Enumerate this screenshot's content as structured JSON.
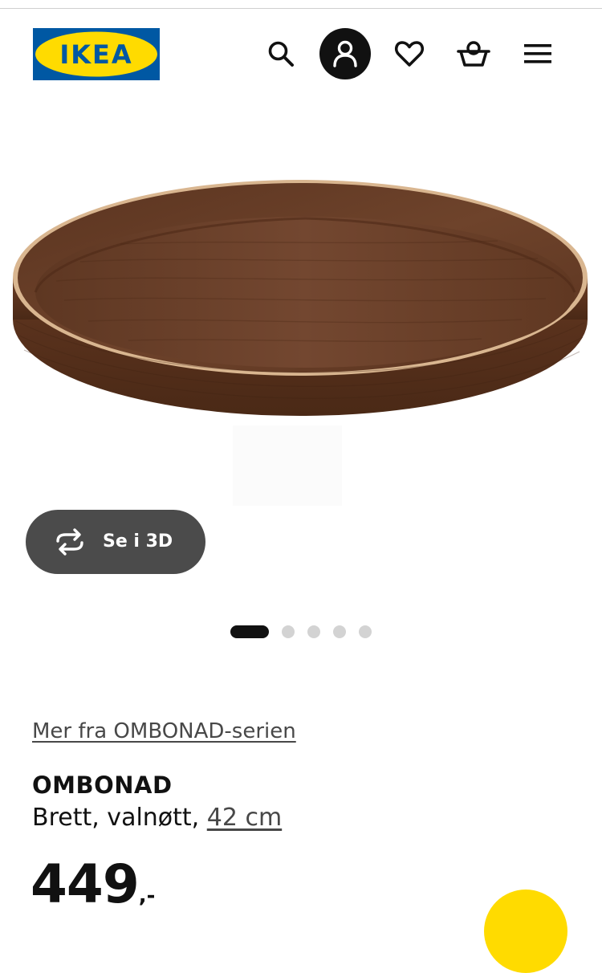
{
  "header": {
    "logo_text": "IKEA",
    "brand_colors": {
      "blue": "#0058a3",
      "yellow": "#ffdb00"
    },
    "icons": [
      "search-icon",
      "account-icon",
      "heart-icon",
      "cart-icon",
      "menu-icon"
    ]
  },
  "product_image": {
    "image_count": 5,
    "active_index": 0
  },
  "view_3d_button": {
    "label": "Se i 3D",
    "icon": "rotate-icon"
  },
  "product": {
    "series_link": "Mer fra OMBONAD-serien",
    "name": "OMBONAD",
    "description": "Brett, valnøtt, ",
    "size_link": "42 cm",
    "price": "449",
    "price_suffix": ",-"
  },
  "colors": {
    "text": "#111111",
    "link": "#484848",
    "button_bg": "#4b4b4b",
    "dot_inactive": "#d3d3d3"
  }
}
